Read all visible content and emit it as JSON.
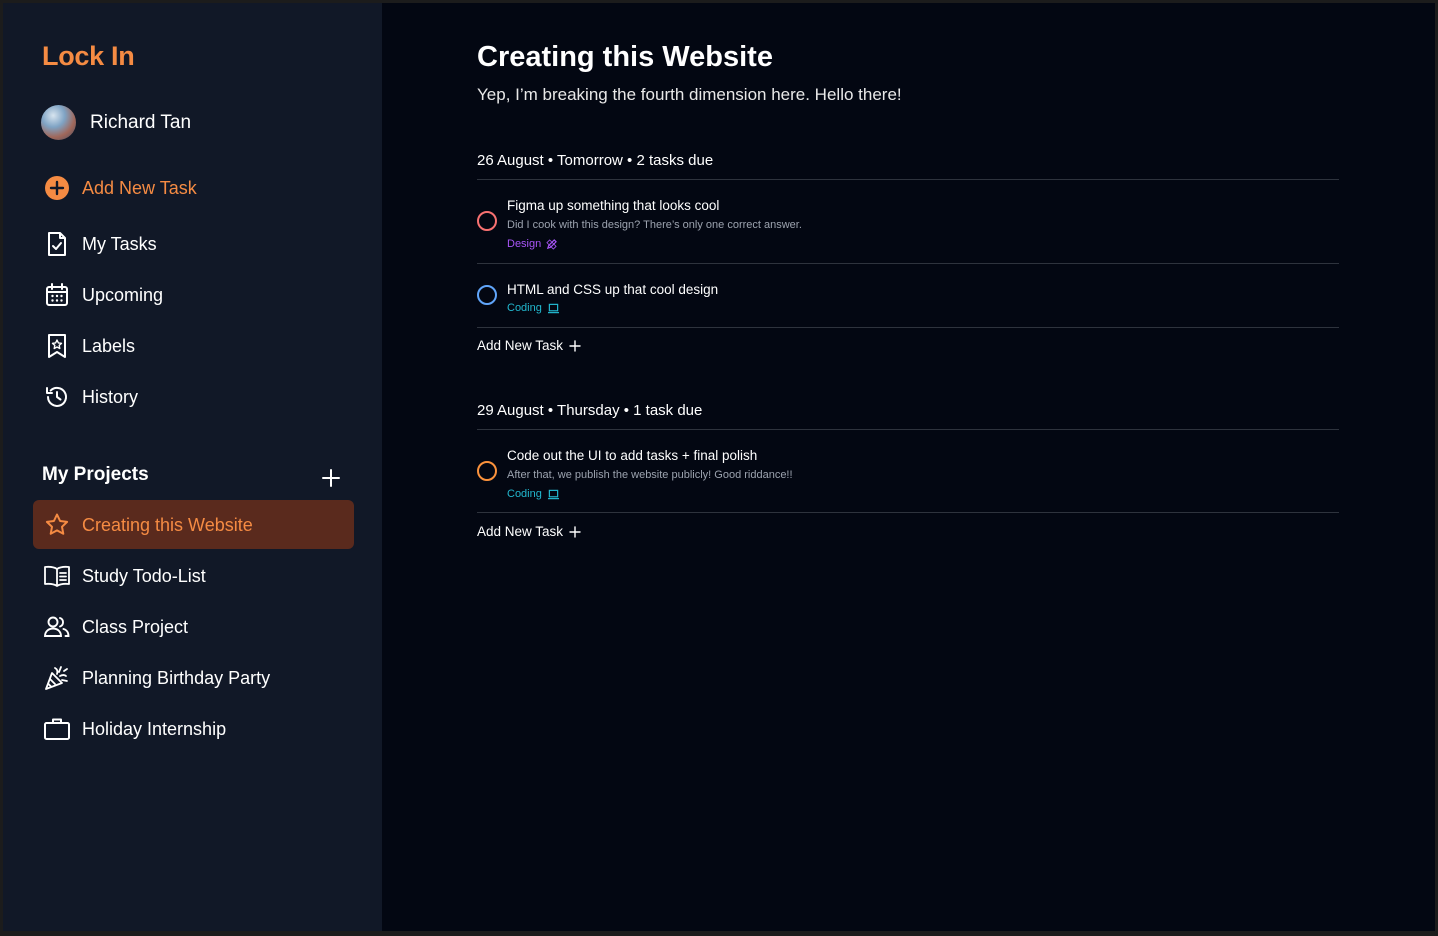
{
  "app": {
    "name": "Lock In"
  },
  "user": {
    "name": "Richard Tan"
  },
  "nav": {
    "add_task": "Add New Task",
    "items": [
      {
        "label": "My Tasks",
        "icon": "task-document-icon"
      },
      {
        "label": "Upcoming",
        "icon": "calendar-icon"
      },
      {
        "label": "Labels",
        "icon": "bookmark-star-icon"
      },
      {
        "label": "History",
        "icon": "history-icon"
      }
    ]
  },
  "projects": {
    "heading": "My Projects",
    "items": [
      {
        "label": "Creating this Website",
        "icon": "star-icon",
        "active": true
      },
      {
        "label": "Study Todo-List",
        "icon": "book-open-icon"
      },
      {
        "label": "Class Project",
        "icon": "users-icon"
      },
      {
        "label": "Planning Birthday Party",
        "icon": "party-popper-icon"
      },
      {
        "label": "Holiday Internship",
        "icon": "briefcase-icon"
      }
    ]
  },
  "main": {
    "title": "Creating this Website",
    "subtitle": "Yep, I’m breaking the fourth dimension here. Hello there!",
    "groups": [
      {
        "heading": "26 August • Tomorrow • 2 tasks due",
        "tasks": [
          {
            "title": "Figma up something that looks cool",
            "description": "Did I cook with this design? There’s only one correct answer.",
            "tag": "Design",
            "tag_icon": "pen-ruler-icon",
            "tag_color": "#a855f7",
            "check_color": "#f87171"
          },
          {
            "title": "HTML and CSS up that cool design",
            "tag": "Coding",
            "tag_icon": "laptop-icon",
            "tag_color": "#22b8cf",
            "check_color": "#60a5fa"
          }
        ],
        "add_label": "Add New Task"
      },
      {
        "heading": "29 August • Thursday • 1 task due",
        "tasks": [
          {
            "title": "Code out the UI to add tasks + final polish",
            "description": "After that, we publish the website publicly! Good riddance!!",
            "tag": "Coding",
            "tag_icon": "laptop-icon",
            "tag_color": "#22b8cf",
            "check_color": "#fb923c"
          }
        ],
        "add_label": "Add New Task"
      }
    ]
  },
  "colors": {
    "accent": "#f58b43",
    "sidebar_bg": "#111827",
    "main_bg": "#030712",
    "active_project_bg": "#5a2a1d"
  }
}
